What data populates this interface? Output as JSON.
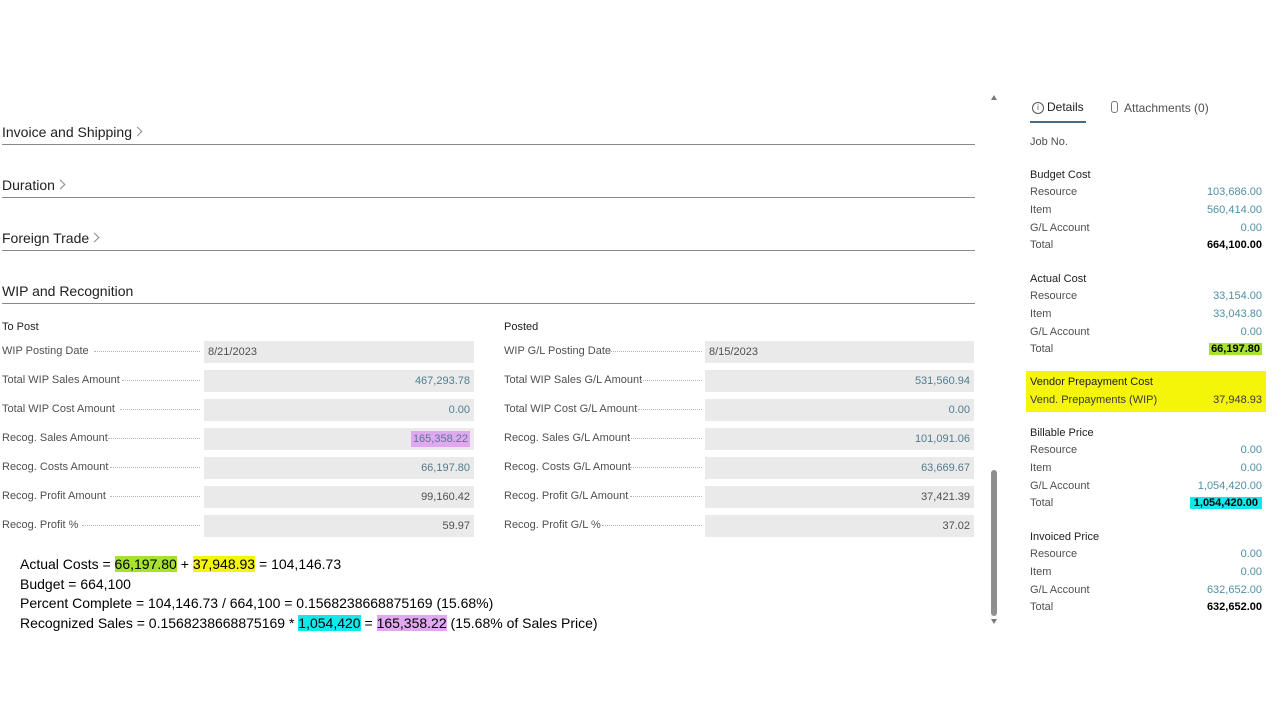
{
  "sections": {
    "invoice_shipping": "Invoice and Shipping",
    "duration": "Duration",
    "foreign_trade": "Foreign Trade",
    "wip_recognition": "WIP and Recognition"
  },
  "wip": {
    "to_post": {
      "title": "To Post",
      "rows": [
        {
          "label": "WIP Posting Date",
          "value": "8/21/2023"
        },
        {
          "label": "Total WIP Sales Amount",
          "value": "467,293.78"
        },
        {
          "label": "Total WIP Cost Amount",
          "value": "0.00"
        },
        {
          "label": "Recog. Sales Amount",
          "value": "165,358.22"
        },
        {
          "label": "Recog. Costs Amount",
          "value": "66,197.80"
        },
        {
          "label": "Recog. Profit Amount",
          "value": "99,160.42"
        },
        {
          "label": "Recog. Profit %",
          "value": "59.97"
        }
      ]
    },
    "posted": {
      "title": "Posted",
      "rows": [
        {
          "label": "WIP G/L Posting Date",
          "value": "8/15/2023"
        },
        {
          "label": "Total WIP Sales G/L Amount",
          "value": "531,560.94"
        },
        {
          "label": "Total WIP Cost G/L Amount",
          "value": "0.00"
        },
        {
          "label": "Recog. Sales G/L Amount",
          "value": "101,091.06"
        },
        {
          "label": "Recog. Costs G/L Amount",
          "value": "63,669.67"
        },
        {
          "label": "Recog. Profit G/L Amount",
          "value": "37,421.39"
        },
        {
          "label": "Recog. Profit G/L %",
          "value": "37.02"
        }
      ]
    }
  },
  "notes": {
    "line1": {
      "prefix": "Actual Costs = ",
      "a": "66,197.80",
      "plus": " + ",
      "b": "37,948.93",
      "suffix": " = 104,146.73"
    },
    "line2": "Budget = 664,100",
    "line3": "Percent Complete = 104,146.73 / 664,100 = 0.1568238668875169 (15.68%)",
    "line4": {
      "prefix": "Recognized Sales = 0.1568238668875169 * ",
      "a": "1,054,420",
      "eq": " = ",
      "b": "165,358.22",
      "suffix": " (15.68% of Sales Price)"
    }
  },
  "factbox": {
    "tab_details": "Details",
    "tab_attachments": "Attachments (0)",
    "job_no_label": "Job No.",
    "budget_cost": {
      "title": "Budget Cost",
      "resource_label": "Resource",
      "resource": "103,686.00",
      "item_label": "Item",
      "item": "560,414.00",
      "gl_label": "G/L Account",
      "gl": "0.00",
      "total_label": "Total",
      "total": "664,100.00"
    },
    "actual_cost": {
      "title": "Actual Cost",
      "resource_label": "Resource",
      "resource": "33,154.00",
      "item_label": "Item",
      "item": "33,043.80",
      "gl_label": "G/L Account",
      "gl": "0.00",
      "total_label": "Total",
      "total": "66,197.80"
    },
    "vendor_prepayment": {
      "title": "Vendor Prepayment Cost",
      "label": "Vend. Prepayments (WIP)",
      "value": "37,948.93"
    },
    "billable_price": {
      "title": "Billable Price",
      "resource_label": "Resource",
      "resource": "0.00",
      "item_label": "Item",
      "item": "0.00",
      "gl_label": "G/L Account",
      "gl": "1,054,420.00",
      "total_label": "Total",
      "total": "1,054,420.00"
    },
    "invoiced_price": {
      "title": "Invoiced Price",
      "resource_label": "Resource",
      "resource": "0.00",
      "item_label": "Item",
      "item": "0.00",
      "gl_label": "G/L Account",
      "gl": "632,652.00",
      "total_label": "Total",
      "total": "632,652.00"
    }
  },
  "colors": {
    "highlight_green": "#a6e22e",
    "highlight_yellow": "#f5f50a",
    "highlight_cyan": "#11e8ea",
    "highlight_purple": "#dfa8f0",
    "link_value": "#4f8fa3"
  }
}
